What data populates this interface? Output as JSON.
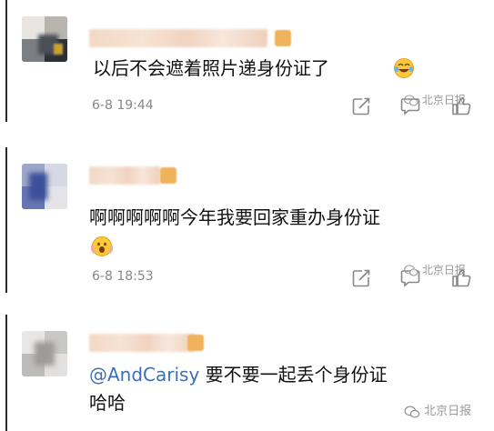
{
  "comments": [
    {
      "text": "以后不会遮着照片递身份证了",
      "emoji": "laughing-tears-emoji",
      "time": "6-8 19:44",
      "watermark": "北京日报"
    },
    {
      "text": "啊啊啊啊啊今年我要回家重办身份证",
      "emoji": "scared-face-emoji",
      "time": "6-8 18:53",
      "watermark": "北京日报"
    },
    {
      "mention": "@AndCarisy",
      "text_after_mention": " 要不要一起丢个身份证",
      "text_line2": "哈哈",
      "watermark": "北京日报"
    }
  ],
  "colors": {
    "mention": "#3b6fb6",
    "time": "#888888",
    "edge": "#2a2a2a"
  }
}
